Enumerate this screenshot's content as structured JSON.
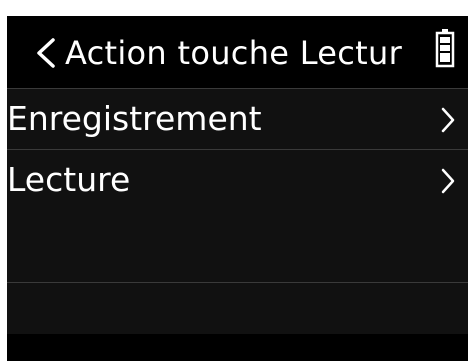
{
  "header": {
    "back_icon": "chevron-left-icon",
    "title": "Action touche Lectur",
    "battery_icon": "battery-full-icon"
  },
  "menu": {
    "items": [
      {
        "label": "Enregistrement",
        "icon": "chevron-right-icon"
      },
      {
        "label": "Lecture",
        "icon": "chevron-right-icon"
      }
    ]
  },
  "colors": {
    "background": "#000000",
    "list_background": "#111111",
    "divider": "#3a3a3a",
    "text": "#ffffff"
  }
}
